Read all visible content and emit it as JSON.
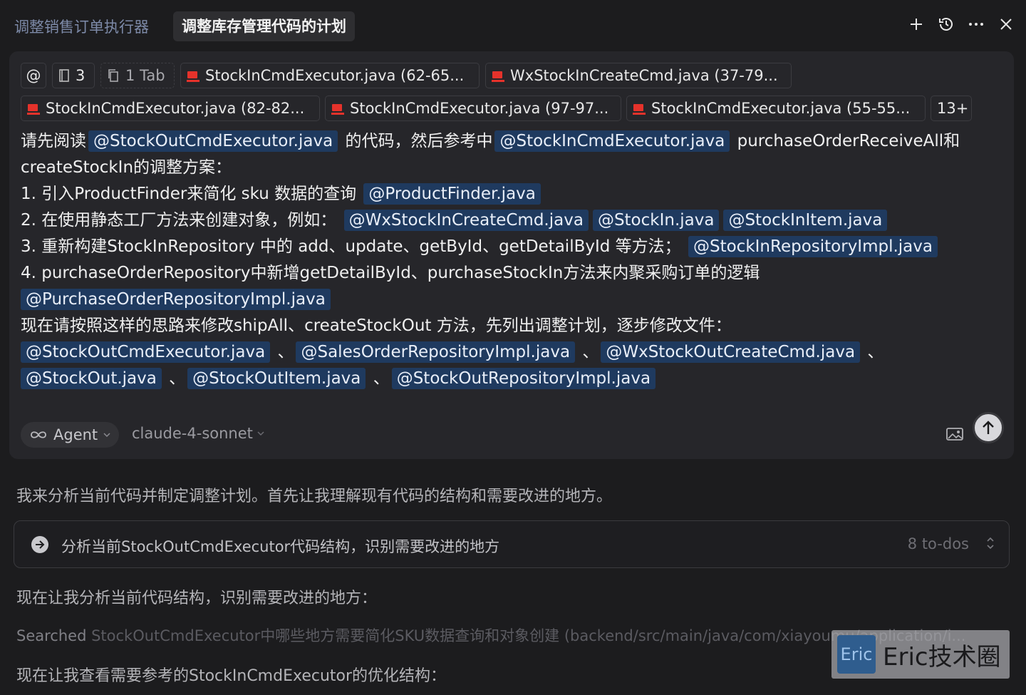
{
  "tabs": {
    "inactive_label": "调整销售订单执行器",
    "active_label": "调整库存管理代码的计划"
  },
  "chips": [
    {
      "label": "@",
      "type": "at"
    },
    {
      "label": "3",
      "type": "book"
    },
    {
      "label": "1 Tab",
      "type": "tab"
    },
    {
      "label": "StockInCmdExecutor.java (62-65...",
      "type": "java"
    },
    {
      "label": "WxStockInCreateCmd.java (37-79...",
      "type": "java"
    },
    {
      "label": "StockInCmdExecutor.java (82-82...",
      "type": "java"
    },
    {
      "label": "StockInCmdExecutor.java (97-97...",
      "type": "java"
    },
    {
      "label": "StockInCmdExecutor.java (55-55...",
      "type": "java"
    },
    {
      "label": "13+",
      "type": "more"
    }
  ],
  "prompt": {
    "l1": {
      "t1": "请先阅读",
      "m1": "@StockOutCmdExecutor.java",
      "t2": " 的代码，然后参考中",
      "m2": "@StockInCmdExecutor.java",
      "t3": " purchaseOrderReceiveAll和"
    },
    "l2": {
      "t1": "createStockIn的调整方案："
    },
    "l3": {
      "t1": "1. 引入ProductFinder来简化 sku 数据的查询 ",
      "m1": "@ProductFinder.java"
    },
    "l4": {
      "t1": "2. 在使用静态工厂方法来创建对象，例如： ",
      "m1": "@WxStockInCreateCmd.java",
      "m2": "@StockIn.java",
      "m3": "@StockInItem.java"
    },
    "l5": {
      "t1": "3. 重新构建StockInRepository 中的 add、update、getById、getDetailById 等方法； ",
      "m1": "@StockInRepositoryImpl.java"
    },
    "l6": {
      "t1": "4. purchaseOrderRepository中新增getDetailById、purchaseStockIn方法来内聚采购订单的逻辑"
    },
    "l7": {
      "m1": "@PurchaseOrderRepositoryImpl.java"
    },
    "l8": {
      "t1": "现在请按照这样的思路来修改shipAll、createStockOut 方法，先列出调整计划，逐步修改文件："
    },
    "l9": {
      "m1": "@StockOutCmdExecutor.java",
      "s1": " 、",
      "m2": "@SalesOrderRepositoryImpl.java",
      "s2": " 、",
      "m3": "@WxStockOutCreateCmd.java",
      "s3": " 、"
    },
    "l10": {
      "m1": "@StockOut.java",
      "s1": " 、",
      "m2": "@StockOutItem.java",
      "s2": " 、",
      "m3": "@StockOutRepositoryImpl.java"
    }
  },
  "composer_footer": {
    "agent_label": "Agent",
    "model_label": "claude-4-sonnet"
  },
  "response": {
    "intro": "我来分析当前代码并制定调整计划。首先让我理解现有代码的结构和需要改进的地方。",
    "todo_text": "分析当前StockOutCmdExecutor代码结构，识别需要改进的地方",
    "todo_count": "8 to-dos",
    "line2": "现在让我分析当前代码结构，识别需要改进的地方：",
    "searched_label": "Searched",
    "searched_query": " StockOutCmdExecutor中哪些地方需要简化SKU数据查询和对象创建 (backend/src/main/java/com/xiayoumu/application/i...",
    "line3": "现在让我查看需要参考的StockInCmdExecutor的优化结构："
  },
  "watermark": {
    "logo_text": "Eric",
    "text": "Eric技术圈"
  }
}
